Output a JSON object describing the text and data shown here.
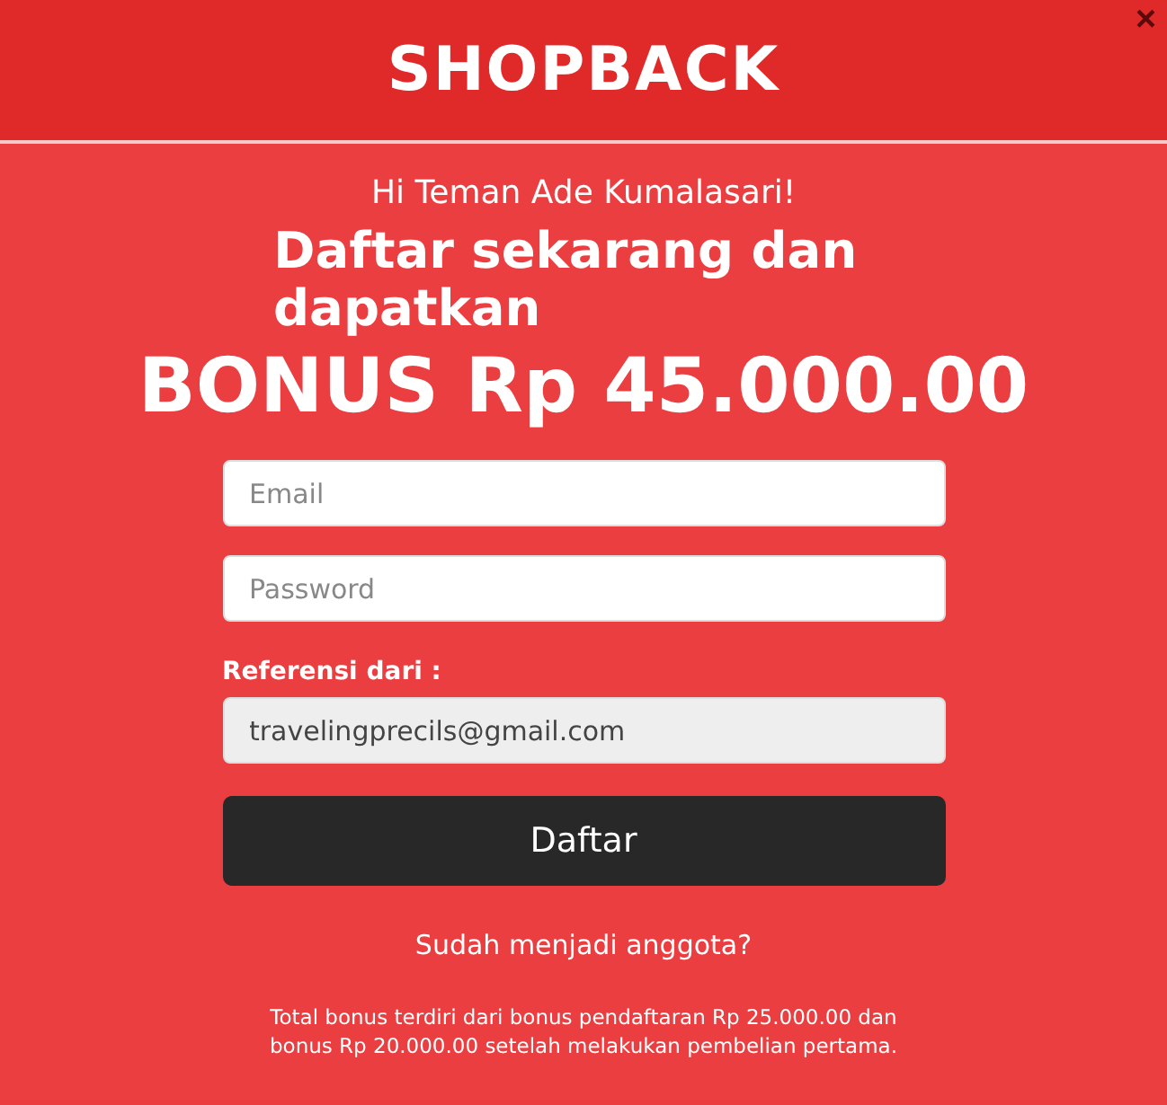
{
  "header": {
    "logo": "SHOPBACK",
    "close": "×"
  },
  "greeting": "Hi Teman Ade Kumalasari!",
  "heading": "Daftar sekarang dan dapatkan",
  "bonus": "BONUS Rp 45.000.00",
  "fields": [
    {
      "placeholder": "Email"
    },
    {
      "placeholder": "Password"
    }
  ],
  "referral": {
    "label": "Referensi dari :",
    "value": "travelingprecils@gmail.com",
    "disabled": true
  },
  "submit": "Daftar",
  "login_link": "Sudah menjadi anggota?",
  "footnote": "Total bonus terdiri dari bonus pendaftaran Rp 25.000.00 dan bonus Rp 20.000.00 setelah melakukan pembelian pertama."
}
